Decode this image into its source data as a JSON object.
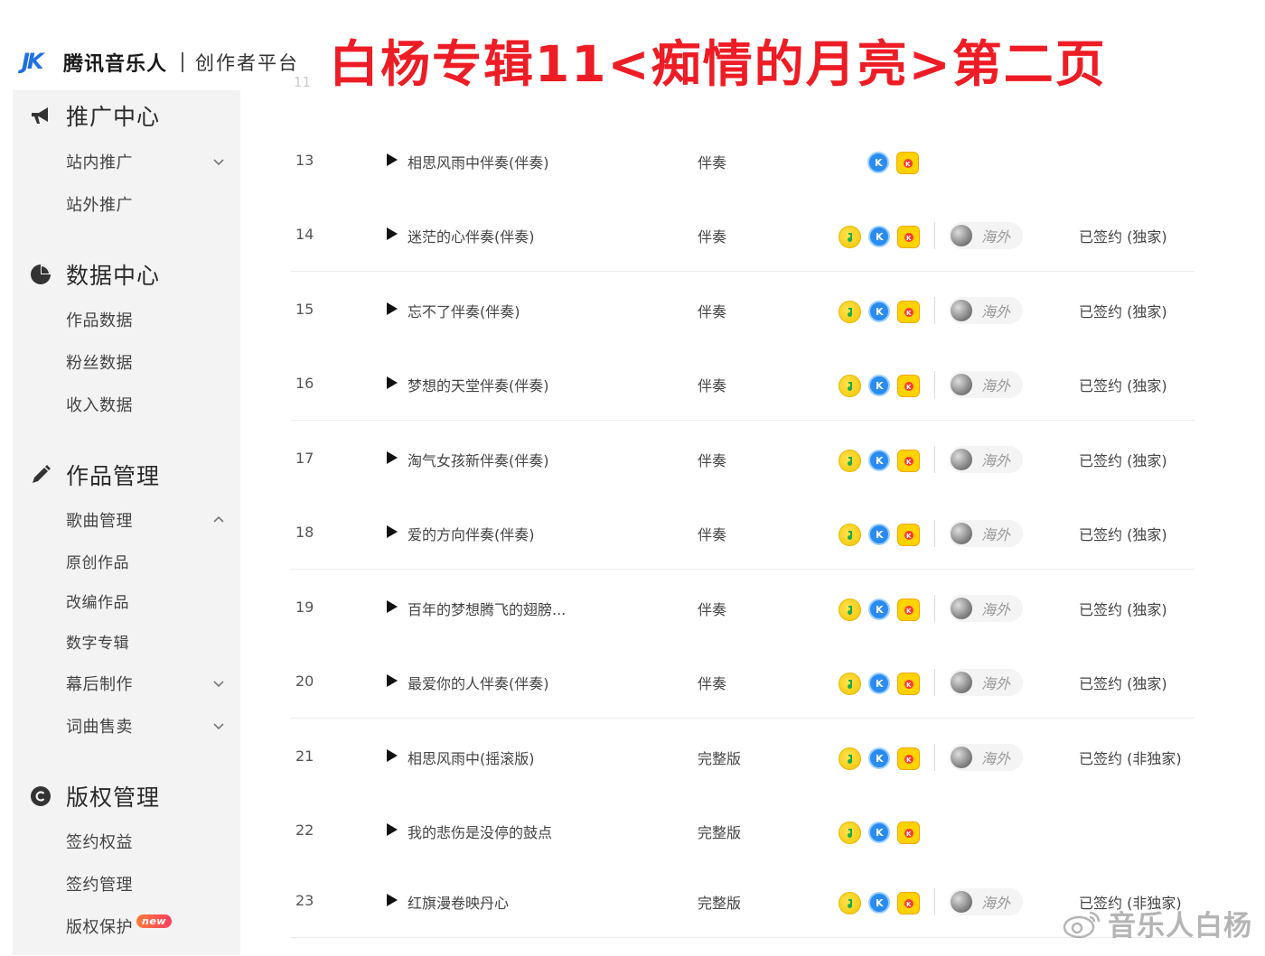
{
  "header": {
    "logo_mark": "JK",
    "brand": "腾讯音乐人",
    "platform": "创作者平台"
  },
  "banner": "白杨专辑11<痴情的月亮>第二页",
  "ghost_row_num": "11",
  "sidebar": {
    "sections": [
      {
        "icon": "megaphone-icon",
        "label": "推广中心",
        "items": [
          {
            "label": "站内推广",
            "chevron": "down"
          },
          {
            "label": "站外推广"
          }
        ]
      },
      {
        "icon": "pie-chart-icon",
        "label": "数据中心",
        "items": [
          {
            "label": "作品数据"
          },
          {
            "label": "粉丝数据"
          },
          {
            "label": "收入数据"
          }
        ]
      },
      {
        "icon": "pencil-icon",
        "label": "作品管理",
        "items": [
          {
            "label": "歌曲管理",
            "chevron": "up"
          },
          {
            "label": "原创作品"
          },
          {
            "label": "改编作品"
          },
          {
            "label": "数字专辑"
          },
          {
            "label": "幕后制作",
            "chevron": "down"
          },
          {
            "label": "词曲售卖",
            "chevron": "down"
          }
        ]
      },
      {
        "icon": "copyright-icon",
        "label": "版权管理",
        "items": [
          {
            "label": "签约权益"
          },
          {
            "label": "签约管理"
          },
          {
            "label": "版权保护",
            "badge": "new"
          }
        ]
      }
    ]
  },
  "rows": [
    {
      "num": "13",
      "title": "相思风雨中伴奏(伴奏)",
      "type": "伴奏",
      "platforms": [
        "kg",
        "kw"
      ],
      "overseas": "",
      "sign": ""
    },
    {
      "num": "14",
      "title": "迷茫的心伴奏(伴奏)",
      "type": "伴奏",
      "platforms": [
        "qq",
        "kg",
        "kw"
      ],
      "overseas": "海外",
      "sign": "已签约 (独家)"
    },
    {
      "num": "15",
      "title": "忘不了伴奏(伴奏)",
      "type": "伴奏",
      "platforms": [
        "qq",
        "kg",
        "kw"
      ],
      "overseas": "海外",
      "sign": "已签约 (独家)"
    },
    {
      "num": "16",
      "title": "梦想的天堂伴奏(伴奏)",
      "type": "伴奏",
      "platforms": [
        "qq",
        "kg",
        "kw"
      ],
      "overseas": "海外",
      "sign": "已签约 (独家)"
    },
    {
      "num": "17",
      "title": "淘气女孩新伴奏(伴奏)",
      "type": "伴奏",
      "platforms": [
        "qq",
        "kg",
        "kw"
      ],
      "overseas": "海外",
      "sign": "已签约 (独家)"
    },
    {
      "num": "18",
      "title": "爱的方向伴奏(伴奏)",
      "type": "伴奏",
      "platforms": [
        "qq",
        "kg",
        "kw"
      ],
      "overseas": "海外",
      "sign": "已签约 (独家)"
    },
    {
      "num": "19",
      "title": "百年的梦想腾飞的翅膀...",
      "type": "伴奏",
      "platforms": [
        "qq",
        "kg",
        "kw"
      ],
      "overseas": "海外",
      "sign": "已签约 (独家)"
    },
    {
      "num": "20",
      "title": "最爱你的人伴奏(伴奏)",
      "type": "伴奏",
      "platforms": [
        "qq",
        "kg",
        "kw"
      ],
      "overseas": "海外",
      "sign": "已签约 (独家)"
    },
    {
      "num": "21",
      "title": "相思风雨中(摇滚版)",
      "type": "完整版",
      "platforms": [
        "qq",
        "kg",
        "kw"
      ],
      "overseas": "海外",
      "sign": "已签约 (非独家)"
    },
    {
      "num": "22",
      "title": "我的悲伤是没停的鼓点",
      "type": "完整版",
      "platforms": [
        "qq",
        "kg",
        "kw"
      ],
      "overseas": "",
      "sign": ""
    },
    {
      "num": "23",
      "title": "红旗漫卷映丹心",
      "type": "完整版",
      "platforms": [
        "qq",
        "kg",
        "kw"
      ],
      "overseas": "海外",
      "sign": "已签约 (非独家)"
    }
  ],
  "watermark": "音乐人白杨",
  "colors": {
    "banner": "#ee1c25",
    "brand_blue": "#1f6fe5",
    "sidebar_bg": "#f3f3f4"
  }
}
